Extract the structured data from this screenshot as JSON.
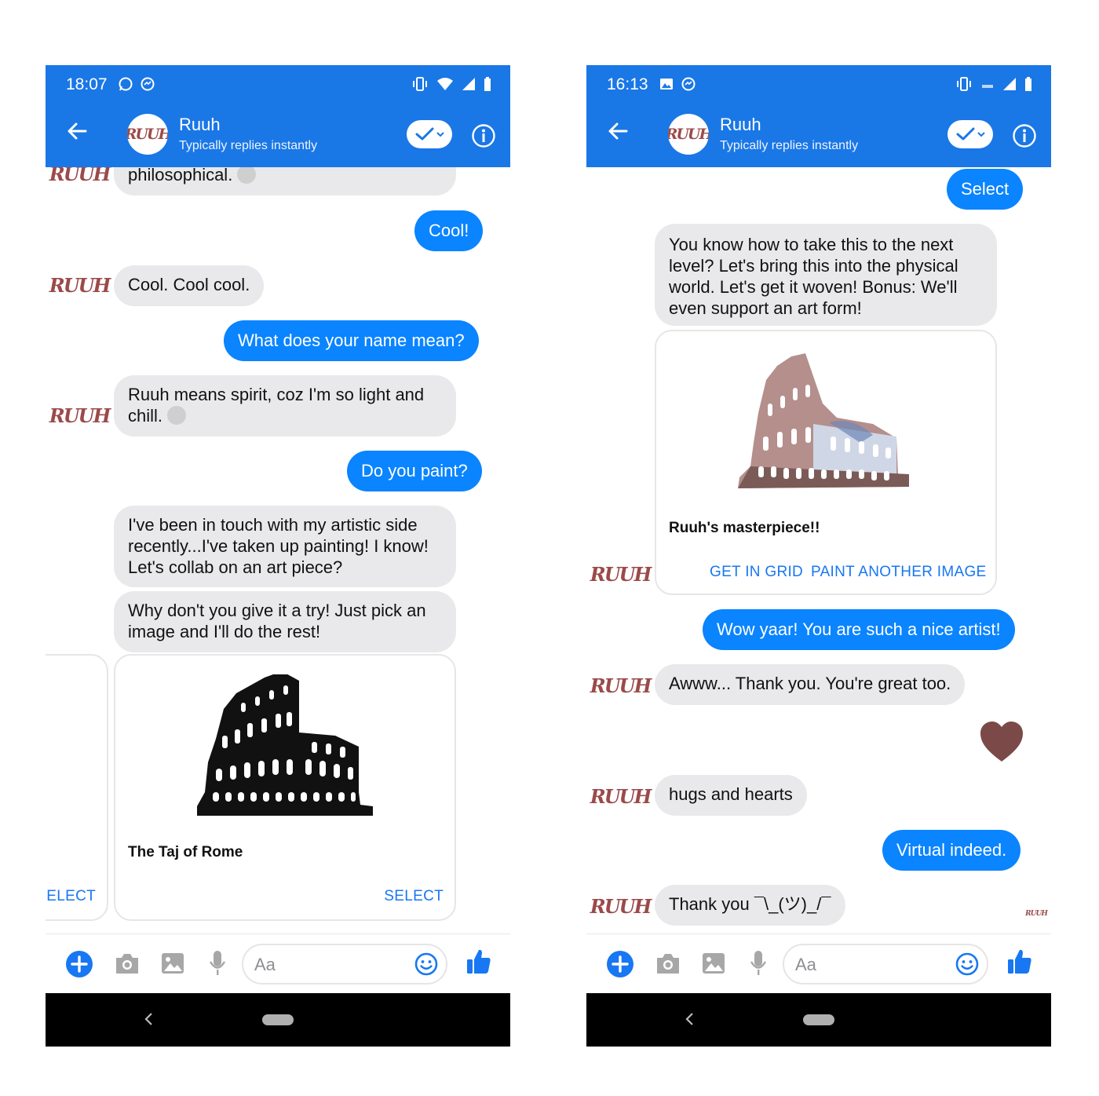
{
  "phones": [
    {
      "status": {
        "time": "18:07"
      },
      "header": {
        "name": "Ruuh",
        "subtitle": "Typically replies instantly",
        "avatar_text": "RUUH"
      },
      "messages": [
        {
          "from": "bot",
          "text": "philosophical."
        },
        {
          "from": "user",
          "text": "Cool!"
        },
        {
          "from": "bot",
          "text": "Cool. Cool cool."
        },
        {
          "from": "user",
          "text": "What does your name mean?"
        },
        {
          "from": "bot",
          "text": "Ruuh means spirit, coz I'm so light and chill."
        },
        {
          "from": "user",
          "text": "Do you paint?"
        },
        {
          "from": "bot",
          "text": "I've been in touch with my artistic side recently...I've taken up painting! I know! Let's collab on an art piece?"
        },
        {
          "from": "bot",
          "text": "Why don't you give it a try! Just pick an image and I'll do the rest!"
        }
      ],
      "carousel": {
        "prev_action": "SELECT",
        "card_title": "The Taj of Rome",
        "card_action": "SELECT"
      },
      "composer": {
        "placeholder": "Aa"
      },
      "bot_avatar_text": "RUUH"
    },
    {
      "status": {
        "time": "16:13"
      },
      "header": {
        "name": "Ruuh",
        "subtitle": "Typically replies instantly",
        "avatar_text": "RUUH"
      },
      "messages": [
        {
          "from": "user",
          "text": "Select"
        },
        {
          "from": "bot",
          "text": "You know how to take this to the next level? Let's bring this into the physical world. Let's get it woven! Bonus: We'll even support an art form!"
        },
        {
          "from": "user",
          "text": "Wow yaar! You are such a nice artist!"
        },
        {
          "from": "bot",
          "text": "Awww... Thank you. You're great too."
        },
        {
          "from": "bot",
          "text": "hugs and hearts"
        },
        {
          "from": "user",
          "text": "Virtual indeed."
        },
        {
          "from": "bot",
          "text": "Thank you ¯\\_(ツ)_/¯"
        }
      ],
      "card": {
        "title": "Ruuh's masterpiece!!",
        "actions": [
          "GET IN GRID",
          "PAINT ANOTHER IMAGE"
        ]
      },
      "heart_color": "#7b4a48",
      "composer": {
        "placeholder": "Aa"
      },
      "bot_avatar_text": "RUUH"
    }
  ],
  "colors": {
    "messenger_blue": "#1a77e6",
    "bubble_blue": "#0a84ff",
    "bubble_grey": "#e9e9eb",
    "logo": "#9b4a4a"
  }
}
